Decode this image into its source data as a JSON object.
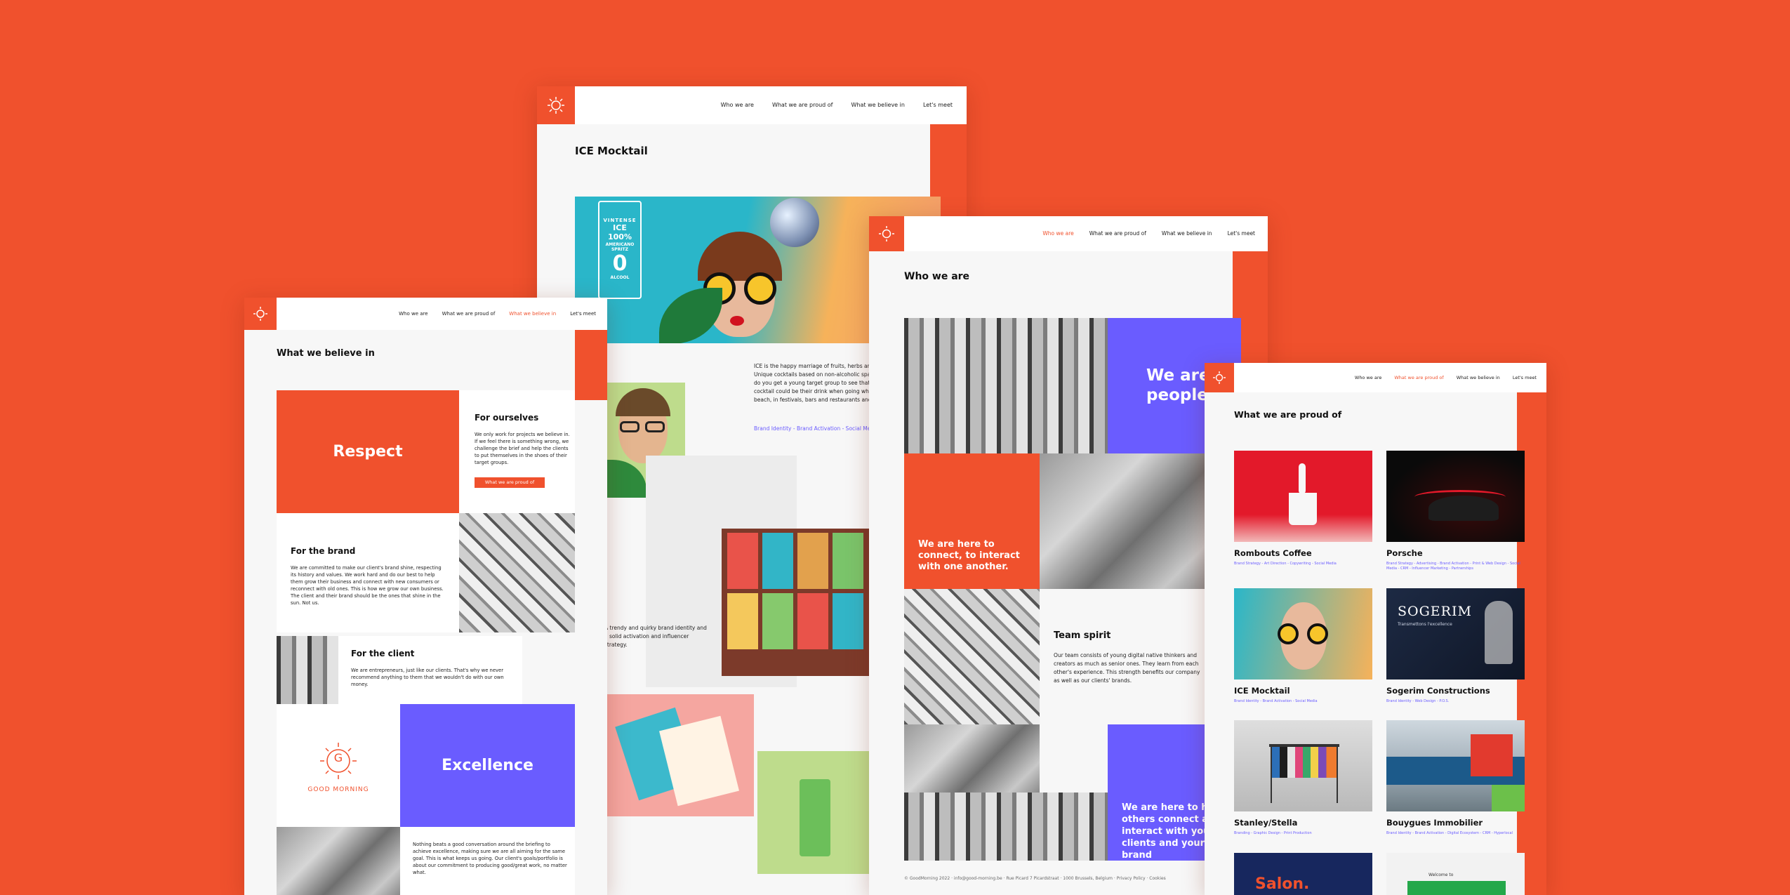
{
  "colors": {
    "background": "#f0512d",
    "accent": "#f0512d",
    "purple": "#6a5cff",
    "green": "#bedc8c"
  },
  "nav": {
    "who": "Who we are",
    "proud": "What we are proud of",
    "believe": "What we believe in",
    "meet": "Let's meet"
  },
  "ice": {
    "title": "ICE Mocktail",
    "can_brand": "VINTENSE",
    "can_line1": "ICE",
    "can_line2": "100%",
    "can_line3": "AMERICANO SPRITZ",
    "can_zero": "0",
    "can_alcool": "ALCOOL",
    "body": "ICE is the happy marriage of fruits, herbs and fine bubbles. Unique cocktails based on non-alcoholic sparkling wine. But how do you get a young target group to see that a non-alcoholic cocktail could be their drink when going where they party: on the beach, in festivals, bars and restaurants and make them try it.",
    "tags": "Brand Identity - Brand Activation - Social Media",
    "body2": "A trendy and quirky brand identity and a solid activation and influencer strategy."
  },
  "believe": {
    "title": "What we believe in",
    "respect": "Respect",
    "ourselves_h": "For ourselves",
    "ourselves_t": "We only work for projects we believe in. If we feel there is something wrong, we challenge the brief and help the clients to put themselves in the shoes of their target groups.",
    "ourselves_btn": "What we are proud of",
    "brand_h": "For the brand",
    "brand_t": "We are committed to make our client's brand shine, respecting its history and values. We work hard and do our best to help them grow their business and connect with new consumers or reconnect with old ones. This is how we grow our own business. The client and their brand should be the ones that shine in the sun. Not us.",
    "client_h": "For the client",
    "client_t": "We are entrepreneurs, just like our clients. That's why we never recommend anything to them that we wouldn't do with our own money.",
    "logo_letter": "G",
    "logo_text": "GOOD MORNING",
    "excellence": "Excellence",
    "excel_t": "Nothing beats a good conversation around the briefing to achieve excellence, making sure we are all aiming for the same goal. This is what keeps us going. Our client's goals/portfolio is about our commitment to producing good/great work, no matter what."
  },
  "who": {
    "title": "Who we are",
    "we_are_people": "We are people",
    "connect": "We are here to connect, to interact with one another.",
    "team_h": "Team spirit",
    "team_t": "Our team consists of young digital native thinkers and creators as much as senior ones. They learn from each other's experience. This strength benefits our company as well as our clients' brands.",
    "others": "We are here to help others connect and interact with your clients and your brand",
    "footer": "© GoodMorning 2022 · info@good-morning.be · Rue Picard 7 Picardstraat · 1000 Brussels, Belgium · Privacy Policy · Cookies"
  },
  "proud": {
    "title": "What we are proud of",
    "projects": [
      {
        "name": "Rombouts Coffee",
        "tags": "Brand Strategy - Art Direction - Copywriting - Social Media"
      },
      {
        "name": "Porsche",
        "tags": "Brand Strategy - Advertising - Brand Activation - Print & Web Design - Social Media - CRM - Influencer Marketing - Partnerships"
      },
      {
        "name": "ICE Mocktail",
        "tags": "Brand Identity - Brand Activation - Social Media"
      },
      {
        "name": "Sogerim Constructions",
        "tags": "Brand Identity - Web Design - P.O.S."
      },
      {
        "name": "Stanley/Stella",
        "tags": "Branding - Graphic Design - Print Production"
      },
      {
        "name": "Bouygues Immobilier",
        "tags": "Brand Identity - Brand Activation - Digital Ecosystem - CRM - Hyperlocal"
      }
    ],
    "sogerim_logo": "SOGERIM",
    "sogerim_sub": "Transmettons l'excellence",
    "salon": "Salon.",
    "welcome": "Welcome to"
  }
}
